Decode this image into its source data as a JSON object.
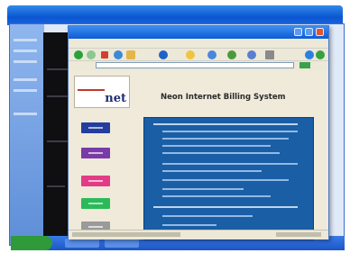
{
  "browser": {
    "title_bar": "",
    "address": ""
  },
  "page": {
    "logo_top": "",
    "logo_mark": "net",
    "heading": "Neon Internet Billing System"
  },
  "colors": {
    "ie_title": "#0d5bd6",
    "content_panel": "#1a5ea6",
    "nav_buttons": [
      "#243d9e",
      "#7a3aa8",
      "#e23c86",
      "#2aba5a",
      "#9a9a9a"
    ]
  }
}
